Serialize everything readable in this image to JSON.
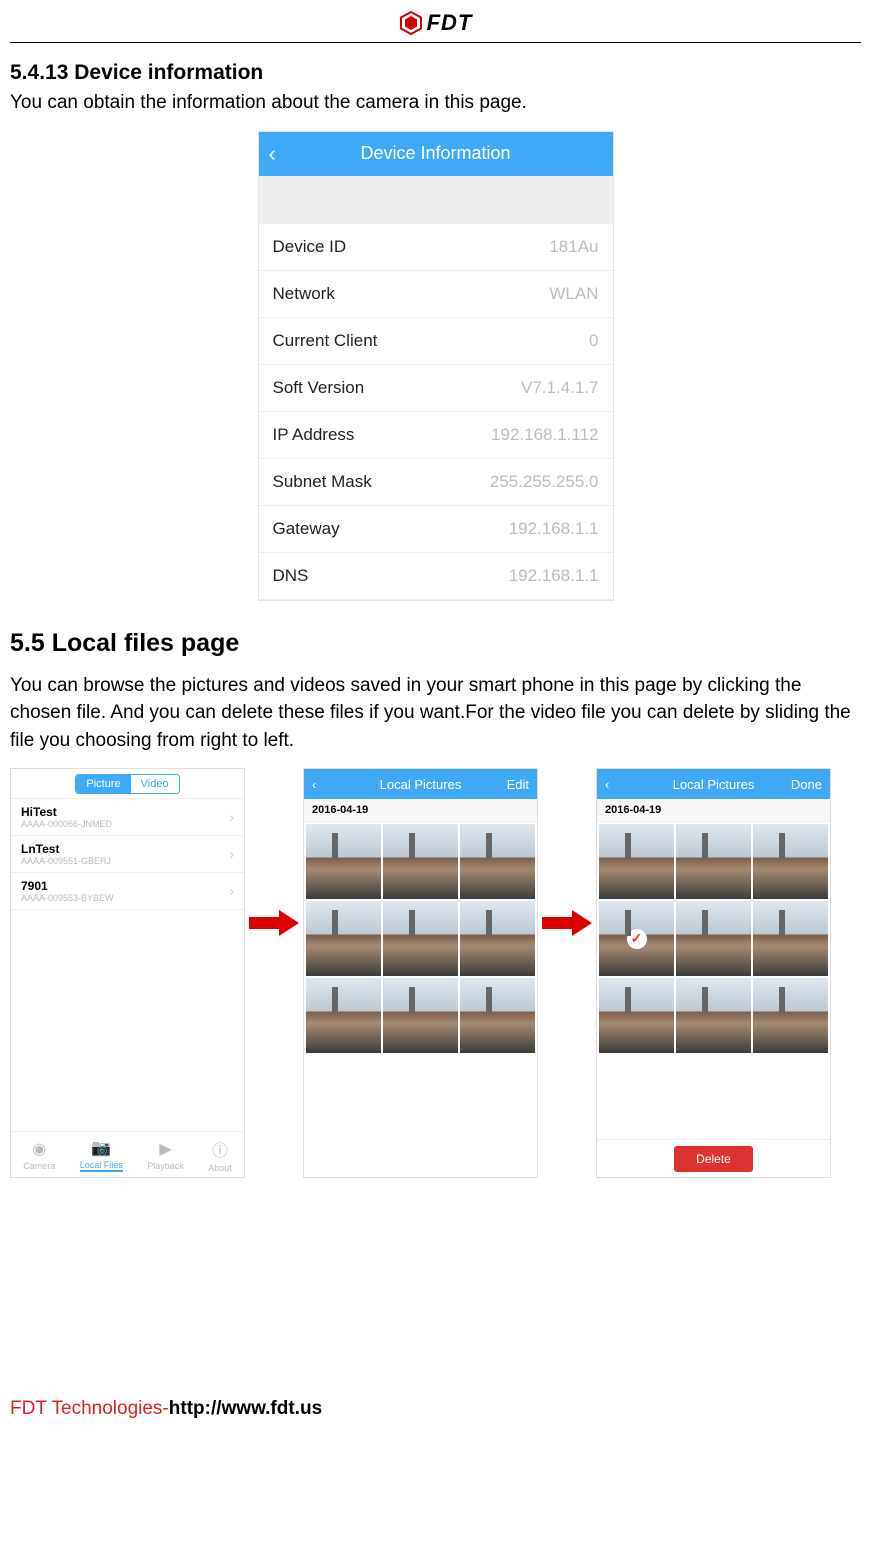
{
  "brand": "FDT",
  "section1": {
    "heading": "5.4.13 Device information",
    "intro": "You can obtain the information about the camera in this page."
  },
  "device_info": {
    "title": "Device Information",
    "rows": [
      {
        "label": "Device ID",
        "value": "181Au"
      },
      {
        "label": "Network",
        "value": "WLAN"
      },
      {
        "label": "Current Client",
        "value": "0"
      },
      {
        "label": "Soft Version",
        "value": "V7.1.4.1.7"
      },
      {
        "label": "IP Address",
        "value": "192.168.1.112"
      },
      {
        "label": "Subnet Mask",
        "value": "255.255.255.0"
      },
      {
        "label": "Gateway",
        "value": "192.168.1.1"
      },
      {
        "label": "DNS",
        "value": "192.168.1.1"
      }
    ]
  },
  "section2": {
    "heading": "5.5 Local files page",
    "intro": "You can browse the pictures and videos saved in your smart phone in this page by clicking the chosen file. And you can delete these files if you want.For the video file you can delete by sliding the file you choosing from right to left."
  },
  "local": {
    "tabs": {
      "picture": "Picture",
      "video": "Video"
    },
    "folders": [
      {
        "title": "HiTest",
        "sub": "AAAA-000066-JNMED"
      },
      {
        "title": "LnTest",
        "sub": "AAAA-009551-GBERJ"
      },
      {
        "title": "7901",
        "sub": "AAAA-009553-BYBEW"
      }
    ],
    "tabbar": [
      "Camera",
      "Local Files",
      "Playback",
      "About"
    ],
    "pictures_title": "Local Pictures",
    "edit": "Edit",
    "done": "Done",
    "date": "2016-04-19",
    "delete": "Delete"
  },
  "footer": {
    "company": "FDT Technologies-",
    "url": "http://www.fdt.us"
  }
}
